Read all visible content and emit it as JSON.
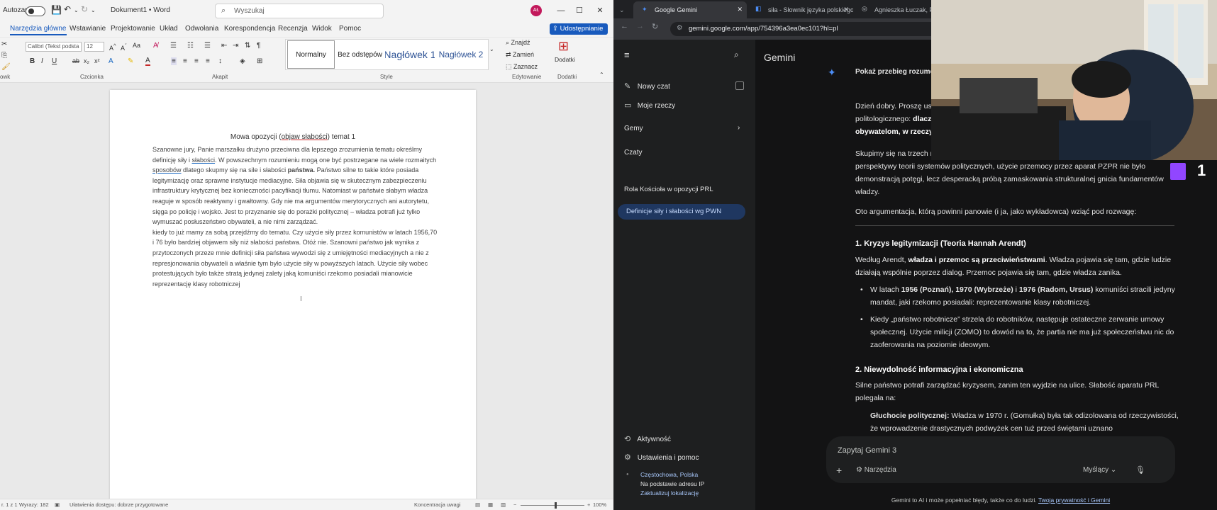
{
  "word": {
    "autosave_label": "Autozapis",
    "doc_name": "Dokument1 • Word",
    "search_placeholder": "Wyszukaj",
    "avatar_initials": "AŁ",
    "tabs": [
      "Narzędzia główne",
      "Wstawianie",
      "Projektowanie",
      "Układ",
      "Odwołania",
      "Korespondencja",
      "Recenzja",
      "Widok",
      "Pomoc"
    ],
    "share_label": "Udostępnianie",
    "font_name": "Calibri (Tekst podsta",
    "font_size": "12",
    "groups": {
      "clipboard": "owk",
      "font": "Czcionka",
      "paragraph": "Akapit",
      "styles": "Style",
      "editing": "Edytowanie",
      "addins": "Dodatki"
    },
    "styles": [
      "Normalny",
      "Bez odstępów",
      "Nagłówek 1",
      "Nagłówek 2"
    ],
    "editing": {
      "find": "Znajdź",
      "replace": "Zamień",
      "select": "Zaznacz"
    },
    "addins_label": "Dodatki",
    "doc_title_pre": "Mowa opozycji (",
    "doc_title_err": "objaw słabości",
    "doc_title_post": ") temat 1",
    "doc_p1_a": "Szanowne jury, Panie marszałku drużyno przeciwna dla lepszego zrozumienia tematu określmy definicję siły i ",
    "doc_p1_err": "słabości",
    "doc_p1_b": ". W powszechnym rozumieniu mogą one być postrzegane na wiele rozmaitych ",
    "doc_p1_err2": "sposobów",
    "doc_p1_c": " dlatego skupmy się na sile i słabości ",
    "doc_p1_bold": "państwa.",
    "doc_p1_d": " Państwo silne to takie które posiada legitymizację oraz sprawne instytucje mediacyjne. Siła objawia się w skutecznym zabezpieczeniu infrastruktury krytycznej bez konieczności pacyfikacji tłumu. Natomiast w państwie słabym władza reaguje w sposób reaktywny i gwałtowny. Gdy nie ma argumentów merytorycznych ani autorytetu, sięga po policję i wojsko. Jest to przyznanie się do porażki politycznej – władza potrafi już tylko wymuszać posłuszeństwo obywateli, a nie nimi zarządzać.",
    "doc_p2": "kiedy to już mamy za sobą przejdźmy do tematu. Czy użycie siły przez komunistów w latach 1956,70 i 76 było bardziej objawem siły niż słabości państwa. Otóż nie. Szanowni państwo jak wynika z przytoczonych przeze mnie definicji siła państwa wywodzi się z umiejętności mediacyjnych a nie z represjonowania obywateli a właśnie tym było użycie siły w powyższych latach. Użycie siły wobec protestujących było także stratą jedynej zalety jaką komuniści rzekomo posiadali mianowicie reprezentację klasy robotniczej",
    "status": {
      "page": "r. 1 z 1",
      "words": "Wyrazy: 182",
      "access": "Ułatwienia dostępu: dobrze przygotowane",
      "focus": "Koncentracja uwagi",
      "zoom": "100%"
    }
  },
  "chrome": {
    "tabs": [
      {
        "title": "Google Gemini",
        "active": true
      },
      {
        "title": "siła - Słownik języka polskiego",
        "active": false
      },
      {
        "title": "Agnieszka Łuczak, Poznańs",
        "active": false
      }
    ],
    "url": "gemini.google.com/app/754396a3ea0ec101?hl=pl"
  },
  "gemini": {
    "title": "Gemini",
    "new_chat": "Nowy czat",
    "my_stuff": "Moje rzeczy",
    "gems": "Gemy",
    "chats_header": "Czaty",
    "chats": [
      "Definicje siły i słabości wg PWN",
      "Rola Kościoła w opozycji PRL"
    ],
    "activity": "Aktywność",
    "settings": "Ustawienia i pomoc",
    "location": "Częstochowa, Polska",
    "location_basis": "Na podstawie adresu IP",
    "update_location": "Zaktualizuj lokalizację",
    "prompt_header": "Pokaż przebieg rozumowa",
    "intro_1": "Dzień dobry. Proszę usi",
    "intro_2": "politologicznego: ",
    "intro_2b": "dlacz",
    "intro_3b": "obywatelom, w rzeczy",
    "focus": "Skupimy się na trzech r",
    "focus_2": "perspektywy teorii systemów politycznych, użycie przemocy przez aparat PZPR nie było demonstracją potęgi, lecz desperacką próbą zamaskowania strukturalnej gnicia fundamentów władzy.",
    "argument_intro": "Oto argumentacja, którą powinni panowie (i ja, jako wykładowca) wziąć pod rozwagę:",
    "h1": "1. Kryzys legitymizacji (Teoria Hannah Arendt)",
    "p1_a": "Według Arendt, ",
    "p1_b": "władza i przemoc są przeciwieństwami",
    "p1_c": ". Władza pojawia się tam, gdzie ludzie działają wspólnie poprzez dialog. Przemoc pojawia się tam, gdzie władza zanika.",
    "li1_a": "W latach ",
    "li1_b": "1956 (Poznań), 1970 (Wybrzeże)",
    "li1_c": " i ",
    "li1_d": "1976 (Radom, Ursus)",
    "li1_e": " komuniści stracili jedyny mandat, jaki rzekomo posiadali: reprezentowanie klasy robotniczej.",
    "li2": "Kiedy „państwo robotnicze” strzela do robotników, następuje ostateczne zerwanie umowy społecznej. Użycie milicji (ZOMO) to dowód na to, że partia nie ma już społeczeństwu nic do zaoferowania na poziomie ideowym.",
    "h2": "2. Niewydolność informacyjna i ekonomiczna",
    "p2": "Silne państwo potrafi zarządzać kryzysem, zanim ten wyjdzie na ulice. Słabość aparatu PRL polegała na:",
    "li3_a": "Głuchocie politycznej:",
    "li3_b": " Władza w 1970 r. (Gomułka) była tak odizolowana od rzeczywistości, że wprowadzenie drastycznych podwyżek cen tuż przed świętami uznano",
    "input_placeholder": "Zapytaj Gemini 3",
    "tools": "Narzędzia",
    "mode": "Myślący",
    "footer_text": "Gemini to AI i może popełniać błędy, także co do ludzi. ",
    "footer_link": "Twoja prywatność i Gemini"
  },
  "overlay": {
    "twitch_count": "1"
  },
  "colors": {
    "word_blue": "#185abd",
    "gemini_bg": "#131314",
    "gemini_side": "#1e1f20",
    "twitch": "#9146ff"
  }
}
